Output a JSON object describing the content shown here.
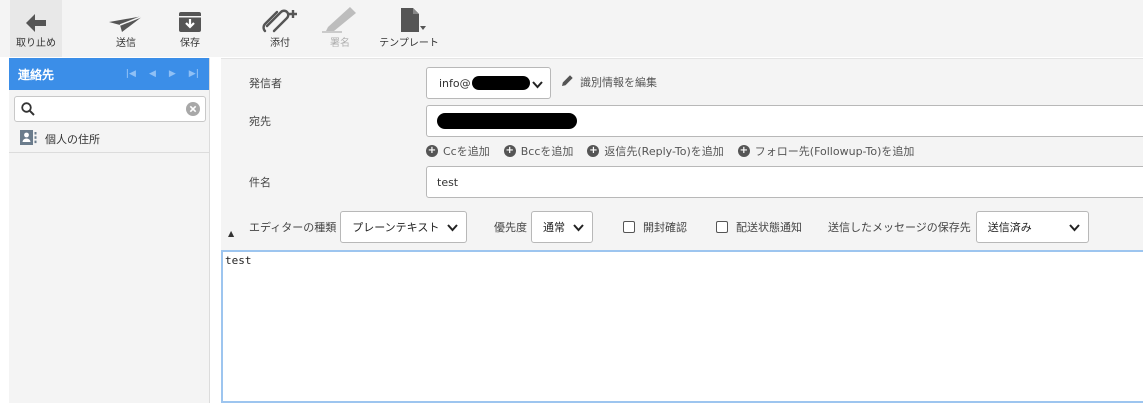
{
  "toolbar": {
    "back": "取り止め",
    "send": "送信",
    "save": "保存",
    "attach": "添付",
    "signature": "署名",
    "template": "テンプレート"
  },
  "contacts": {
    "title": "連絡先",
    "search_value": "",
    "item": "個人の住所"
  },
  "compose": {
    "from_label": "発信者",
    "from_value": "info@",
    "edit_identity": "識別情報を編集",
    "to_label": "宛先",
    "add_cc": "Ccを追加",
    "add_bcc": "Bccを追加",
    "add_reply_to": "返信先(Reply-To)を追加",
    "add_followup_to": "フォロー先(Followup-To)を追加",
    "subject_label": "件名",
    "subject_value": "test"
  },
  "options": {
    "editor_type_label": "エディターの種類",
    "editor_type_value": "プレーンテキスト",
    "priority_label": "優先度",
    "priority_value": "通常",
    "read_receipt": "開封確認",
    "delivery_status": "配送状態通知",
    "save_sent_label": "送信したメッセージの保存先",
    "save_sent_value": "送信済み"
  },
  "editor": {
    "body": "test"
  }
}
